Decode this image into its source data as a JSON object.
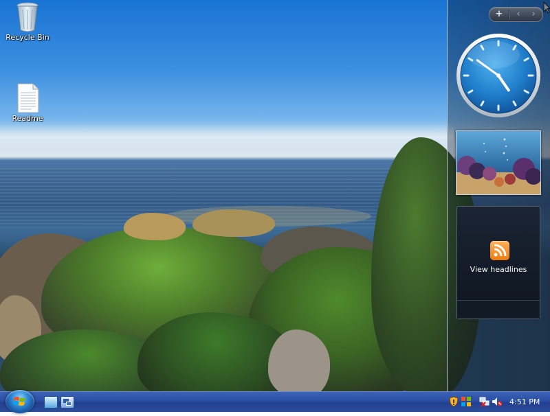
{
  "desktop": {
    "icons": [
      {
        "label": "Recycle Bin",
        "icon": "recycle-bin-icon"
      },
      {
        "label": "Readme",
        "icon": "text-document-icon"
      }
    ]
  },
  "sidebar": {
    "controls": {
      "add": "+",
      "prev": "‹",
      "next": "›"
    },
    "clock": {
      "hour": 4,
      "minute": 51
    },
    "feed": {
      "label": "View headlines",
      "icon": "rss-icon"
    }
  },
  "taskbar": {
    "start_icon": "windows-logo-icon",
    "quick_launch": [
      "show-desktop-icon",
      "switch-windows-icon"
    ],
    "tray": [
      "security-shield-icon",
      "windows-update-icon",
      "network-icon",
      "volume-muted-icon"
    ],
    "time": "4:51 PM"
  },
  "colors": {
    "taskbar": "#2a4ea3",
    "accent": "#f07b10"
  }
}
